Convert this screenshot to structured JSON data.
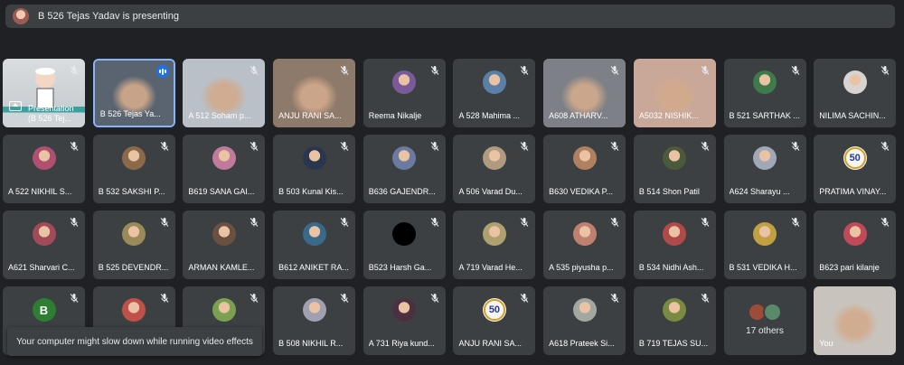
{
  "banner": {
    "text": "B 526 Tejas Yadav is presenting"
  },
  "toast": {
    "text": "Your computer might slow down while running video effects"
  },
  "others": {
    "label": "17 others"
  },
  "tiles": [
    {
      "name": "Presentation (B 526 Tej...",
      "type": "presentation"
    },
    {
      "name": "B 526 Tejas Ya...",
      "type": "video",
      "presenting": true,
      "bg": "#5a6470"
    },
    {
      "name": "A 512 Soham p...",
      "type": "video",
      "bg": "#b9c0c8"
    },
    {
      "name": "ANJU RANI SA...",
      "type": "video",
      "bg": "#8d7a6a"
    },
    {
      "name": "Reema Nikalje",
      "color": "#7a5a9a"
    },
    {
      "name": "A 528 Mahima ...",
      "color": "#5b7fa6"
    },
    {
      "name": "A608 ATHARV...",
      "type": "video",
      "bg": "#7d8086"
    },
    {
      "name": "A5032 NISHIK...",
      "type": "video",
      "bg": "#c9a89a"
    },
    {
      "name": "B 521 SARTHAK ...",
      "color": "#3f7a4a"
    },
    {
      "name": "NILIMA SACHIN...",
      "color": "#d8d4d2"
    },
    {
      "name": "A 522 NIKHIL S...",
      "color": "#b05070"
    },
    {
      "name": "B 532 SAKSHI P...",
      "color": "#8a6a4a"
    },
    {
      "name": "B619 SANA GAI...",
      "color": "#c07a9a"
    },
    {
      "name": "B 503 Kunal Kis...",
      "color": "#2a3550"
    },
    {
      "name": "B636 GAJENDR...",
      "color": "#6a7aa0"
    },
    {
      "name": "A 506 Varad Du...",
      "color": "#b09a80"
    },
    {
      "name": "B630 VEDIKA P...",
      "color": "#b08060"
    },
    {
      "name": "B 514 Shon Patil",
      "color": "#4a5a3a"
    },
    {
      "name": "A624 Sharayu ...",
      "color": "#a0a8b8"
    },
    {
      "name": "PRATIMA VINAY...",
      "color": "#2e3a6a",
      "badge": "50"
    },
    {
      "name": "A621 Sharvari C...",
      "color": "#a04a5a"
    },
    {
      "name": "B 525 DEVENDR...",
      "color": "#9a8a5a"
    },
    {
      "name": "ARMAN KAMLE...",
      "color": "#6a5040"
    },
    {
      "name": "B612 ANIKET RA...",
      "color": "#3a6a8a"
    },
    {
      "name": "B523 Harsh Ga...",
      "color": "#000000"
    },
    {
      "name": "A 719 Varad He...",
      "color": "#b0a070"
    },
    {
      "name": "A 535 piyusha p...",
      "color": "#c08070"
    },
    {
      "name": "B 534 Nidhi Ash...",
      "color": "#b04a4a"
    },
    {
      "name": "B 531 VEDIKA H...",
      "color": "#c0a040"
    },
    {
      "name": "B623 pari kilanje",
      "color": "#c04a5a"
    },
    {
      "name": "",
      "color": "#2e7d32",
      "letter": "B"
    },
    {
      "name": "",
      "color": "#c0504a"
    },
    {
      "name": "",
      "color": "#7aa050"
    },
    {
      "name": "B 508 NIKHIL R...",
      "color": "#a0a0b0"
    },
    {
      "name": "A 731 Riya kund...",
      "color": "#4a3040"
    },
    {
      "name": "ANJU RANI SA...",
      "color": "#2e3a6a",
      "badge": "50"
    },
    {
      "name": "A618 Prateek Si...",
      "color": "#a0a8a0"
    },
    {
      "name": "B 719 TEJAS SU...",
      "color": "#7a8a40"
    },
    {
      "name": "",
      "type": "others"
    },
    {
      "name": "You",
      "type": "video",
      "bg": "#c8c4bd"
    }
  ],
  "icons": {
    "mic_off": "mic-off-icon",
    "speaking": "audio-level-icon",
    "present": "present-screen-icon"
  },
  "colors": {
    "background": "#202124",
    "tile": "#3c4043",
    "accent": "#8ab4f8"
  }
}
